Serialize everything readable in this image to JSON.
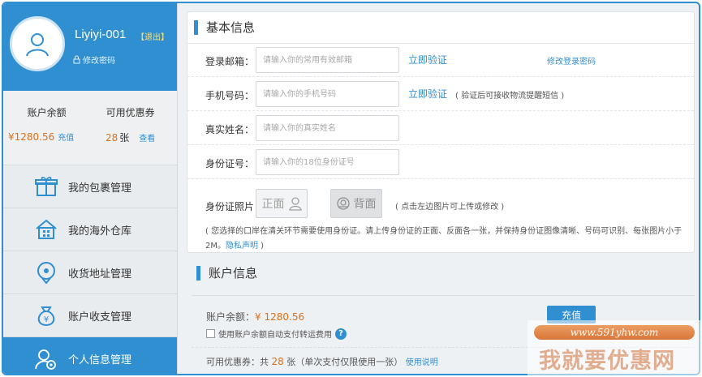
{
  "colors": {
    "accent": "#2f8fd0",
    "orange": "#d9711c",
    "sidebar_bg": "#e9ecef"
  },
  "profile": {
    "username": "Liyiyi-001",
    "logout_label": "【退出】",
    "change_password_label": "修改密码",
    "avatar_icon": "user-icon",
    "lock_icon": "lock-icon"
  },
  "balance": {
    "balance_label": "账户余额",
    "balance_value": "¥1280.56",
    "recharge_link": "充值",
    "coupons_label": "可用优惠券",
    "coupons_count": "28",
    "coupons_unit": "张",
    "view_link": "查看"
  },
  "menu": [
    {
      "label": "我的包裹管理",
      "icon": "gift-icon"
    },
    {
      "label": "我的海外仓库",
      "icon": "warehouse-icon"
    },
    {
      "label": "收货地址管理",
      "icon": "location-pin-icon"
    },
    {
      "label": "账户收支管理",
      "icon": "money-bag-icon"
    },
    {
      "label": "个人信息管理",
      "icon": "user-settings-icon",
      "active": true
    }
  ],
  "basic_info": {
    "title": "基本信息",
    "email": {
      "label": "登录邮箱：",
      "placeholder": "请输入你的常用有效邮箱",
      "verify": "立即验证",
      "modify": "修改登录密码"
    },
    "phone": {
      "label": "手机号码：",
      "placeholder": "请输入你的手机号码",
      "verify": "立即验证",
      "note": "( 验证后可接收物流提醒短信 )"
    },
    "real_name": {
      "label": "真实姓名：",
      "placeholder": "请输入你的真实姓名"
    },
    "id_number": {
      "label": "身份证号：",
      "placeholder": "请输入你的18位身份证号"
    },
    "id_photo": {
      "label": "身份证照片：",
      "front": "正面",
      "back": "背面",
      "note": "( 点击左边图片可上传或修改 )"
    },
    "notice": "( 您选择的口岸在清关环节需要使用身份证。请上传身份证的正面、反面各一张，并保持身份证图像清晰、号码可识别、每张图片小于2M。",
    "privacy_link": "隐私声明",
    "notice_end": " )"
  },
  "account_info": {
    "title": "账户信息",
    "balance_label": "账户余额：",
    "balance_value": "¥ 1280.56",
    "recharge_button": "充值",
    "auto_pay_label": "使用账户余额自动支付转运费用",
    "coupons_prefix": "可用优惠券：共",
    "coupons_count": "28",
    "coupons_suffix": "张（单次支付仅限使用一张）",
    "usage_link": "使用说明"
  },
  "watermark": {
    "url": "www.591yhw.com",
    "text": "我就要优惠网"
  }
}
